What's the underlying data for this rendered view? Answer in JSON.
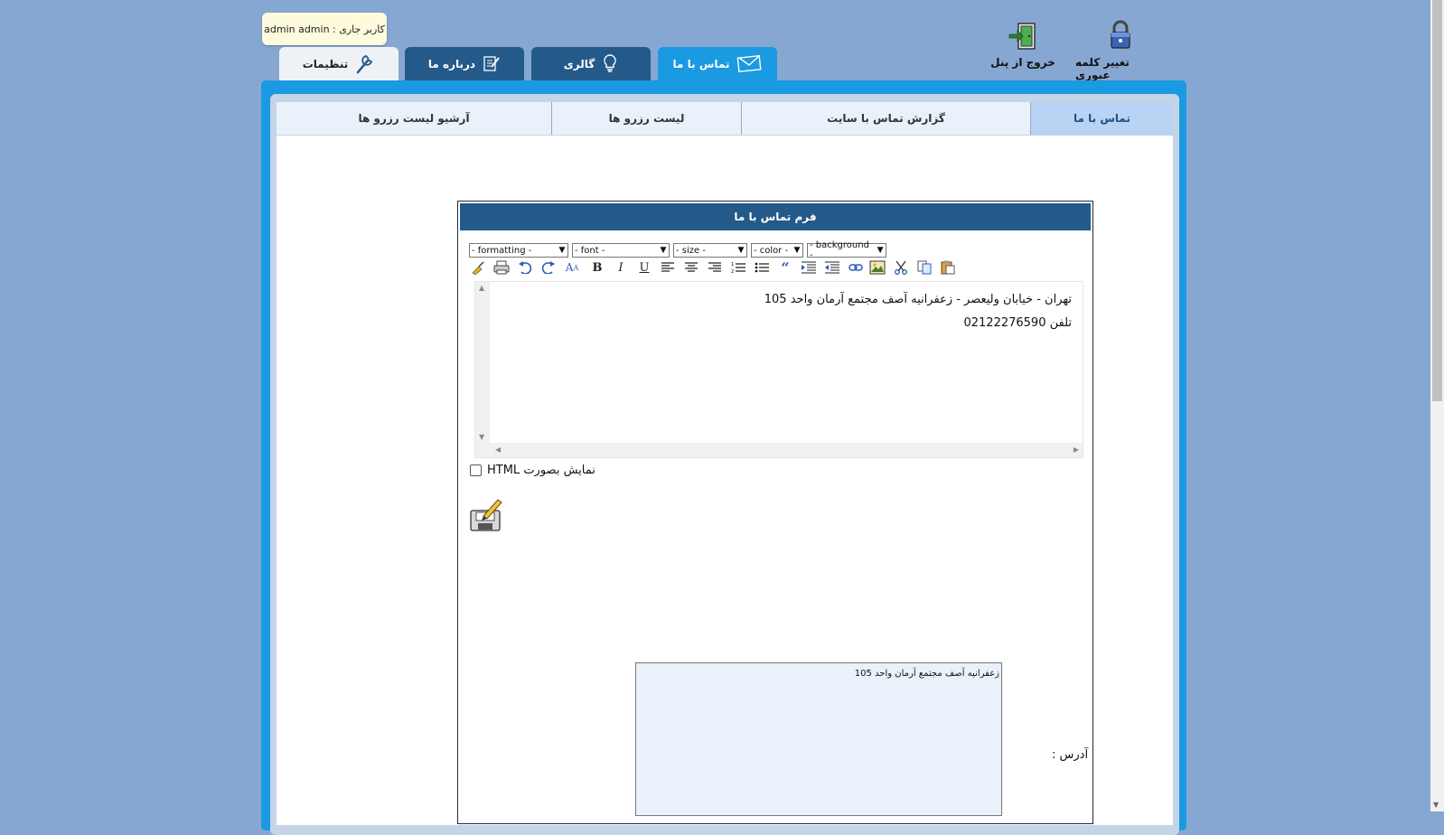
{
  "header": {
    "current_user": "کاربر جاری : admin admin",
    "change_password_label": "تغییر کلمه عبوری",
    "logout_label": "خروج از پنل"
  },
  "main_tabs": [
    {
      "label": "تماس با ما",
      "icon": "envelope-icon",
      "active": true
    },
    {
      "label": "گالری",
      "icon": "lightbulb-icon",
      "active": false
    },
    {
      "label": "درباره ما",
      "icon": "edit-note-icon",
      "active": false
    },
    {
      "label": "تنظیمات",
      "icon": "wrench-icon",
      "active": false
    }
  ],
  "sub_tabs": [
    {
      "label": "تماس با ما",
      "active": true
    },
    {
      "label": "گزارش تماس با سایت",
      "active": false
    },
    {
      "label": "لیست رزرو ها",
      "active": false
    },
    {
      "label": "آرشیو لیست رزرو ها",
      "active": false
    }
  ],
  "form": {
    "title": "فرم تماس با ما",
    "toolbar_selects": [
      "- formatting -",
      "- font -",
      "- size -",
      "- color -",
      "- background -"
    ],
    "toolbar_buttons": [
      "clean-icon",
      "print-icon",
      "undo-icon",
      "redo-icon",
      "font-size-icon",
      "bold-icon",
      "italic-icon",
      "underline-icon",
      "align-left-icon",
      "align-center-icon",
      "align-right-icon",
      "ordered-list-icon",
      "unordered-list-icon",
      "quote-icon",
      "indent-icon",
      "outdent-icon",
      "link-icon",
      "image-icon",
      "cut-icon",
      "copy-icon",
      "paste-icon"
    ],
    "editor_lines": [
      "تهران - خیابان ولیعصر - زعفرانیه آصف مجتمع آرمان واحد 105",
      "تلفن 02122276590"
    ],
    "html_toggle_label": "نمایش بصورت HTML",
    "address_label": "آدرس :",
    "address_value": "زعفرانیه آصف مجتمع آرمان واحد 105"
  },
  "colors": {
    "background": "#87a7d3",
    "tab_dark": "#245a8a",
    "tab_active": "#1a9ae0",
    "subtab_active": "#b8d3f3"
  }
}
